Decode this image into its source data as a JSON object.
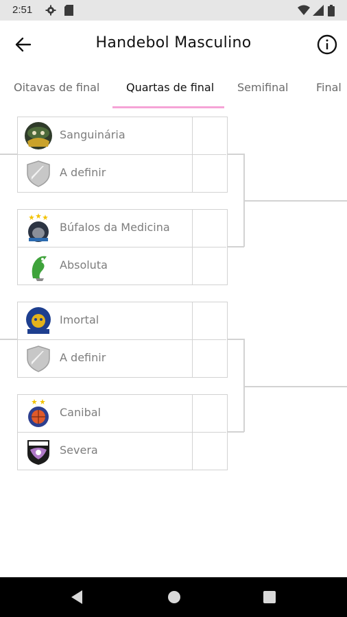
{
  "status_bar": {
    "time": "2:51"
  },
  "header": {
    "title": "Handebol Masculino"
  },
  "tabs": [
    {
      "label": "Oitavas de final"
    },
    {
      "label": "Quartas de final"
    },
    {
      "label": "Semifinal"
    },
    {
      "label": "Final"
    }
  ],
  "active_tab_index": 1,
  "colors": {
    "accent": "#f6a3d6",
    "line": "#d2d2d2",
    "team_text": "#7d7d7d"
  },
  "matches": [
    {
      "team1": {
        "name": "Sanguinária",
        "logo": "sanguinaria-logo"
      },
      "team2": {
        "name": "A definir",
        "logo": "shield-placeholder"
      },
      "score1": "",
      "score2": ""
    },
    {
      "team1": {
        "name": "Búfalos da Medicina",
        "logo": "bufalos-logo"
      },
      "team2": {
        "name": "Absoluta",
        "logo": "absoluta-logo"
      },
      "score1": "",
      "score2": ""
    },
    {
      "team1": {
        "name": "Imortal",
        "logo": "imortal-logo"
      },
      "team2": {
        "name": "A definir",
        "logo": "shield-placeholder"
      },
      "score1": "",
      "score2": ""
    },
    {
      "team1": {
        "name": "Canibal",
        "logo": "canibal-logo"
      },
      "team2": {
        "name": "Severa",
        "logo": "severa-logo"
      },
      "score1": "",
      "score2": ""
    }
  ]
}
